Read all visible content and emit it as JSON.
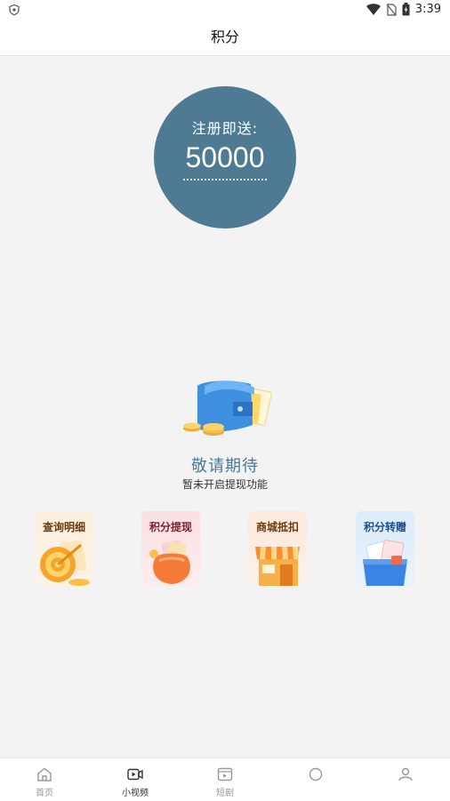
{
  "status_bar": {
    "time": "3:39"
  },
  "header": {
    "title": "积分"
  },
  "bonus": {
    "label": "注册即送:",
    "value": "50000"
  },
  "empty_state": {
    "title": "敬请期待",
    "subtitle": "暂未开启提现功能"
  },
  "features": [
    {
      "label": "查询明细",
      "icon": "target-icon"
    },
    {
      "label": "积分提现",
      "icon": "money-bag-icon"
    },
    {
      "label": "商城抵扣",
      "icon": "store-icon"
    },
    {
      "label": "积分转赠",
      "icon": "gift-box-icon"
    }
  ],
  "tab_bar": {
    "active": 1,
    "items": [
      {
        "label": "首页",
        "icon": "home-icon"
      },
      {
        "label": "小视频",
        "icon": "video-icon"
      },
      {
        "label": "短剧",
        "icon": "film-icon"
      },
      {
        "label": "",
        "icon": "tab-icon"
      },
      {
        "label": "",
        "icon": "tab-icon"
      }
    ]
  },
  "colors": {
    "accent": "#4e7a93",
    "background": "#f3f3f3"
  }
}
